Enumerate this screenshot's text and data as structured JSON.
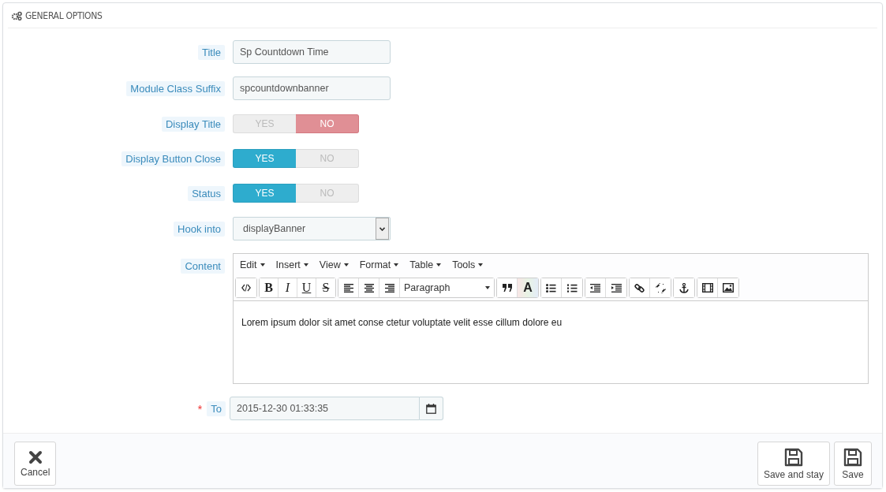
{
  "panel": {
    "title": "GENERAL OPTIONS"
  },
  "fields": [
    {
      "kind": "text",
      "label": "Title",
      "value": "Sp Countdown Time"
    },
    {
      "kind": "text",
      "label": "Module Class Suffix",
      "value": "spcountdownbanner"
    },
    {
      "kind": "switch",
      "label": "Display Title",
      "options": [
        {
          "label": "YES",
          "selected": false
        },
        {
          "label": "NO",
          "selected": true
        }
      ]
    },
    {
      "kind": "switch",
      "label": "Display Button Close",
      "options": [
        {
          "label": "YES",
          "selected": true
        },
        {
          "label": "NO",
          "selected": false
        }
      ]
    },
    {
      "kind": "switch",
      "label": "Status",
      "options": [
        {
          "label": "YES",
          "selected": true
        },
        {
          "label": "NO",
          "selected": false
        }
      ]
    },
    {
      "kind": "select",
      "label": "Hook into",
      "value": "displayBanner"
    },
    {
      "kind": "editor",
      "label": "Content",
      "menus": [
        "Edit",
        "Insert",
        "View",
        "Format",
        "Table",
        "Tools"
      ],
      "text_styles": [
        "B",
        "I",
        "U",
        "S"
      ],
      "format": "Paragraph",
      "text_color_label": "A",
      "text": "Lorem ipsum dolor sit amet conse ctetur voluptate velit esse cillum dolore eu"
    },
    {
      "kind": "date",
      "label": "To",
      "required": true,
      "required_mark": "*",
      "value": "2015-12-30 01:33:35"
    }
  ],
  "footer": {
    "cancel": {
      "label": "Cancel"
    },
    "save_buttons": [
      {
        "label": "Save and stay"
      },
      {
        "label": "Save"
      }
    ]
  }
}
